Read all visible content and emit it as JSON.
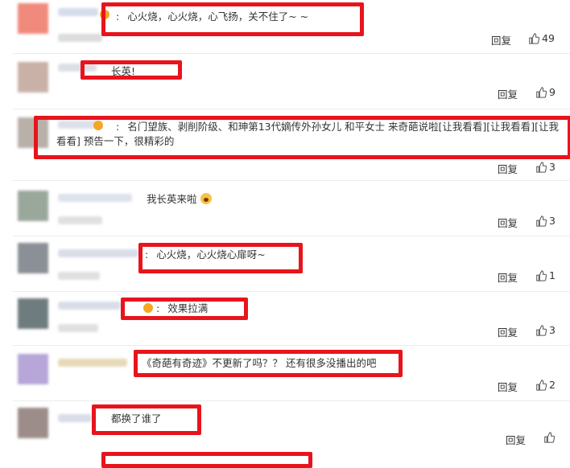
{
  "comments": [
    {
      "text": "心火烧，心火烧，心飞扬，关不住了~ ~",
      "prefix": ":",
      "reply": "回复",
      "likes": "49",
      "avatar_color": "#f08a7c"
    },
    {
      "text": "长英!",
      "prefix": "",
      "reply": "回复",
      "likes": "9",
      "avatar_color": "#c9b1a8"
    },
    {
      "text": "名门望族、剥削阶级、和珅第13代嫡传外孙女儿 和平女士 来奇葩说啦[让我看看][让我看看][让我看看] 预告一下，很精彩的",
      "prefix": ":",
      "reply": "回复",
      "likes": "3",
      "avatar_color": "#b9b0a9"
    },
    {
      "text": "我长英来啦",
      "prefix": "",
      "reply": "回复",
      "likes": "3",
      "avatar_color": "#9aa89b"
    },
    {
      "text": "心火烧，心火烧心扉呀~",
      "prefix": ":",
      "reply": "回复",
      "likes": "1",
      "avatar_color": "#8b9096"
    },
    {
      "text": "效果拉满",
      "prefix": ":",
      "reply": "回复",
      "likes": "3",
      "avatar_color": "#6f7c7f"
    },
    {
      "text": "《奇葩有奇迹》不更新了吗？？ 还有很多没播出的吧",
      "prefix": "",
      "reply": "回复",
      "likes": "2",
      "avatar_color": "#b7a6d8"
    },
    {
      "text": "都换了谁了",
      "prefix": "",
      "reply": "回复",
      "likes": "",
      "avatar_color": "#9c8d8a"
    }
  ],
  "colors": {
    "highlight_box": "#e8141c",
    "text": "#333333",
    "separator": "#ececec"
  },
  "icons": {
    "like": "thumbs-up-icon",
    "emoji": "fearful-face-icon",
    "badge": "vip-badge-icon"
  }
}
